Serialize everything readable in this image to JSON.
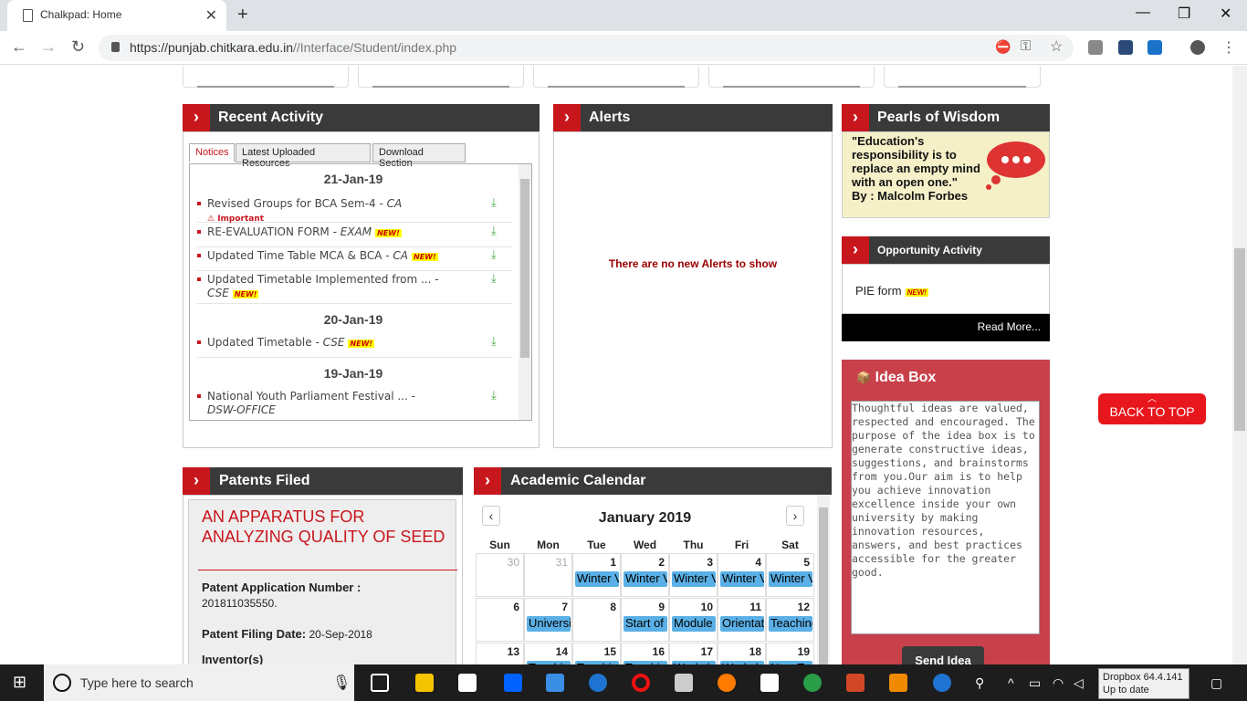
{
  "browser": {
    "tab_title": "Chalkpad: Home",
    "url_host": "https://punjab.chitkara.edu.in",
    "url_path": "//Interface/Student/index.php"
  },
  "recent": {
    "title": "Recent Activity",
    "tabs": [
      "Notices",
      "Latest Uploaded Resources",
      "Download Section"
    ],
    "dates": [
      "21-Jan-19",
      "20-Jan-19",
      "19-Jan-19"
    ],
    "items": [
      {
        "text": "Revised Groups for BCA Sem-4 - ",
        "cat": "CA",
        "flag": "Important"
      },
      {
        "text": "RE-EVALUATION FORM - ",
        "cat": "EXAM",
        "badge": "NEW!"
      },
      {
        "text": "Updated Time Table MCA & BCA - ",
        "cat": "CA",
        "badge": "NEW!"
      },
      {
        "text": "Updated Timetable Implemented from ... - ",
        "cat": "CSE",
        "badge": "NEW!"
      },
      {
        "text": "Updated Timetable - ",
        "cat": "CSE",
        "badge": "NEW!"
      },
      {
        "text": "National Youth Parliament Festival ... - ",
        "cat": "DSW-OFFICE"
      }
    ]
  },
  "alerts": {
    "title": "Alerts",
    "empty": "There are no new Alerts to show"
  },
  "pearls": {
    "title": "Pearls of Wisdom",
    "quote": "\"Education's responsibility is to replace an empty mind with an open one.\"",
    "by": "By :  Malcolm Forbes"
  },
  "opportunity": {
    "title": "Opportunity Activity",
    "item": "PIE form",
    "badge": "NEW!",
    "read_more": "Read More..."
  },
  "idea": {
    "title": "Idea Box",
    "text": "Thoughtful ideas are valued, respected and encouraged. The purpose of the idea box is to generate constructive ideas, suggestions, and brainstorms from you.Our aim is to help you achieve innovation excellence inside your own university by making innovation resources, answers, and best practices accessible for the greater good.",
    "send": "Send Idea"
  },
  "back_to_top": "BACK TO TOP",
  "patents": {
    "title": "Patents Filed",
    "name": "AN APPARATUS FOR ANALYZING QUALITY OF SEED",
    "app_label": "Patent Application Number :",
    "app_value": "201811035550.",
    "filing_label": "Patent Filing Date:",
    "filing_value": "20-Sep-2018",
    "inventor_label": "Inventor(s)"
  },
  "calendar": {
    "title": "Academic Calendar",
    "month": "January 2019",
    "days": [
      "Sun",
      "Mon",
      "Tue",
      "Wed",
      "Thu",
      "Fri",
      "Sat"
    ],
    "week1": [
      {
        "d": "30",
        "grey": true
      },
      {
        "d": "31",
        "grey": true
      },
      {
        "d": "1",
        "ev": "Winter Vacation"
      },
      {
        "d": "2",
        "ev": "Winter Vacation"
      },
      {
        "d": "3",
        "ev": "Winter Vacation"
      },
      {
        "d": "4",
        "ev": "Winter Vacation"
      },
      {
        "d": "5",
        "ev": "Winter Vacation"
      }
    ],
    "week2": [
      {
        "d": "6"
      },
      {
        "d": "7",
        "ev": "University"
      },
      {
        "d": "8"
      },
      {
        "d": "9",
        "ev": "Start of"
      },
      {
        "d": "10",
        "ev": "Module"
      },
      {
        "d": "11",
        "ev": "Orientation"
      },
      {
        "d": "12",
        "ev": "Teaching"
      }
    ],
    "week3": [
      {
        "d": "13"
      },
      {
        "d": "14",
        "ev": "Teaching"
      },
      {
        "d": "15",
        "ev": "Teaching"
      },
      {
        "d": "16",
        "ev": "Teaching"
      },
      {
        "d": "17",
        "ev": "Workshop"
      },
      {
        "d": "18",
        "ev": "Workshop"
      },
      {
        "d": "19",
        "ev": "New Term"
      }
    ]
  },
  "taskbar": {
    "search": "Type here to search",
    "dropbox_line1": "Dropbox 64.4.141",
    "dropbox_line2": "Up to date"
  }
}
